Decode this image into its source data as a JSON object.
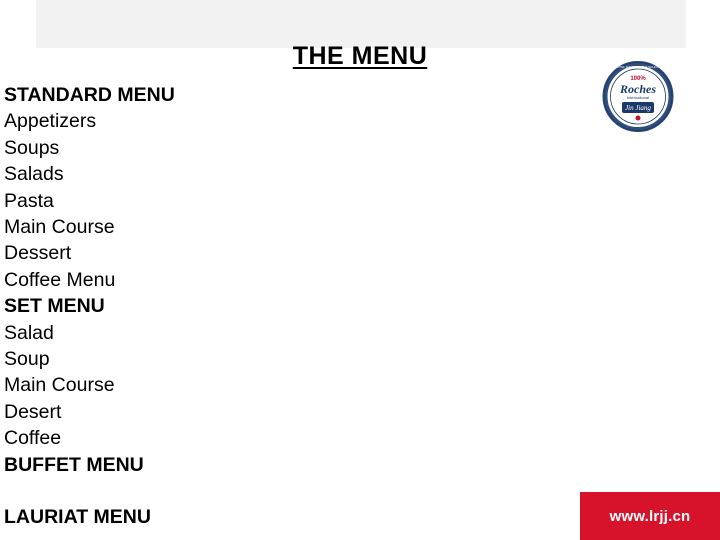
{
  "slide": {
    "title": "THE MENU",
    "menu_sections": [
      {
        "label": "STANDARD MENU",
        "bold": true,
        "gap_before": false
      },
      {
        "label": "Appetizers",
        "bold": false,
        "gap_before": false
      },
      {
        "label": "Soups",
        "bold": false,
        "gap_before": false
      },
      {
        "label": "Salads",
        "bold": false,
        "gap_before": false
      },
      {
        "label": "Pasta",
        "bold": false,
        "gap_before": false
      },
      {
        "label": "Main Course",
        "bold": false,
        "gap_before": false
      },
      {
        "label": "Dessert",
        "bold": false,
        "gap_before": false
      },
      {
        "label": "Coffee Menu",
        "bold": false,
        "gap_before": false
      },
      {
        "label": "SET MENU",
        "bold": true,
        "gap_before": false
      },
      {
        "label": "Salad",
        "bold": false,
        "gap_before": false
      },
      {
        "label": "Soup",
        "bold": false,
        "gap_before": false
      },
      {
        "label": "Main Course",
        "bold": false,
        "gap_before": false
      },
      {
        "label": "Desert",
        "bold": false,
        "gap_before": false
      },
      {
        "label": "Coffee",
        "bold": false,
        "gap_before": false
      },
      {
        "label": "BUFFET MENU",
        "bold": true,
        "gap_before": false
      },
      {
        "label": "LAURIAT MENU",
        "bold": true,
        "gap_before": true
      }
    ],
    "logo": {
      "top_text": "100%",
      "main_text": "Roches",
      "sub_text": "International",
      "brand_text": "Jin Jiang",
      "ring_text_left": "HOTEL MANAGEMENT SCHOOL",
      "ring_text_right": "LES ROCHES JIN JIANG INTERNATIONAL HOTEL MANAGEMENT"
    },
    "footer": {
      "url": "www.lrjj.cn",
      "accent_color": "#d7122b"
    }
  }
}
